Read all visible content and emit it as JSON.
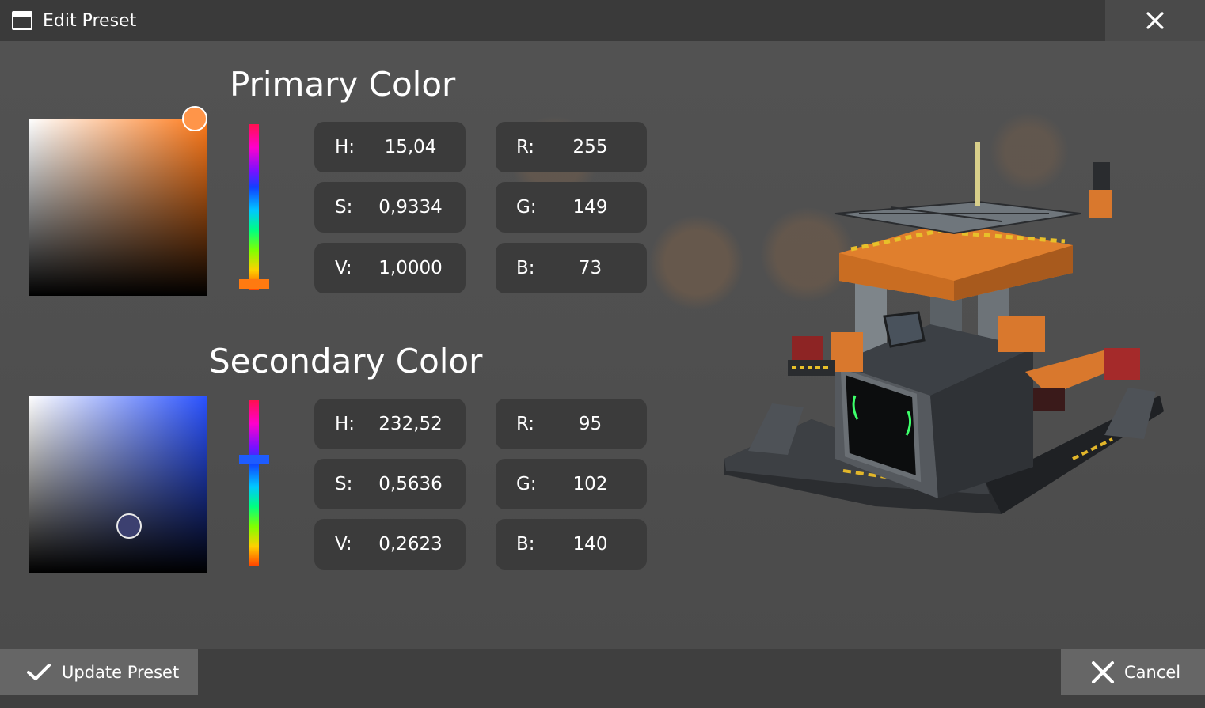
{
  "window": {
    "title": "Edit Preset",
    "icon": "window-icon",
    "close_icon": "close-icon"
  },
  "primary": {
    "heading": "Primary Color",
    "color": "#ff9549",
    "hue_bar_value": 0.9,
    "hsv": [
      {
        "label": "H:",
        "value": "15,04"
      },
      {
        "label": "S:",
        "value": "0,9334"
      },
      {
        "label": "V:",
        "value": "1,0000"
      }
    ],
    "rgb": [
      {
        "label": "R:",
        "value": "255"
      },
      {
        "label": "G:",
        "value": "149"
      },
      {
        "label": "B:",
        "value": "73"
      }
    ]
  },
  "secondary": {
    "heading": "Secondary Color",
    "color": "#5f668c",
    "hue_bar_value": 0.35,
    "hsv": [
      {
        "label": "H:",
        "value": "232,52"
      },
      {
        "label": "S:",
        "value": "0,5636"
      },
      {
        "label": "V:",
        "value": "0,2623"
      }
    ],
    "rgb": [
      {
        "label": "R:",
        "value": "95"
      },
      {
        "label": "G:",
        "value": "102"
      },
      {
        "label": "B:",
        "value": "140"
      }
    ]
  },
  "footer": {
    "update_label": "Update Preset",
    "update_icon": "checkmark-icon",
    "cancel_label": "Cancel",
    "cancel_icon": "close-icon"
  }
}
